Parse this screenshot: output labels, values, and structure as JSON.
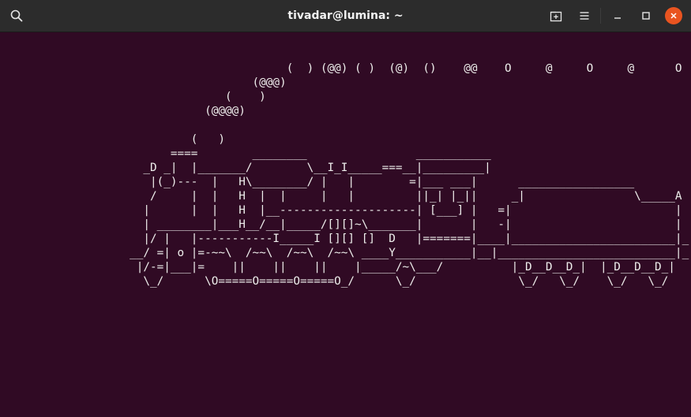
{
  "window": {
    "title": "tivadar@lumina: ~"
  },
  "icons": {
    "search": "search-icon",
    "new_tab": "new-tab-icon",
    "menu": "hamburger-menu-icon",
    "minimize": "minimize-icon",
    "maximize": "maximize-icon",
    "close": "close-icon"
  },
  "colors": {
    "terminal_bg": "#300a24",
    "titlebar_bg": "#2c2c2c",
    "text": "#eeeeec",
    "close_accent": "#e95420"
  },
  "terminal": {
    "lines": [
      "                                          (  ) (@@) ( )  (@)  ()    @@    O     @     O     @      O",
      "                                     (@@@)",
      "                                 (    )",
      "                              (@@@@)",
      "",
      "                            (   )",
      "                         ====        ________                ___________",
      "                     _D _|  |_______/        \\__I_I_____===__|_________|",
      "                      |(_)---  |   H\\________/ |   |        =|___ ___|      _________________",
      "                      /     |  |   H  |  |     |   |         ||_| |_||     _|                \\_____A",
      "                     |      |  |   H  |__--------------------| [___] |   =|                        |",
      "                     | ________|___H__/__|_____/[][]~\\_______|       |   -|                        |",
      "                     |/ |   |-----------I_____I [][] []  D   |=======|____|________________________|_",
      "                   __/ =| o |=-~~\\  /~~\\  /~~\\  /~~\\ ____Y___________|__|__________________________|_",
      "                    |/-=|___|=    ||    ||    ||    |_____/~\\___/          |_D__D__D_|  |_D__D__D_|",
      "                     \\_/      \\O=====O=====O=====O_/      \\_/               \\_/   \\_/    \\_/   \\_/"
    ]
  }
}
